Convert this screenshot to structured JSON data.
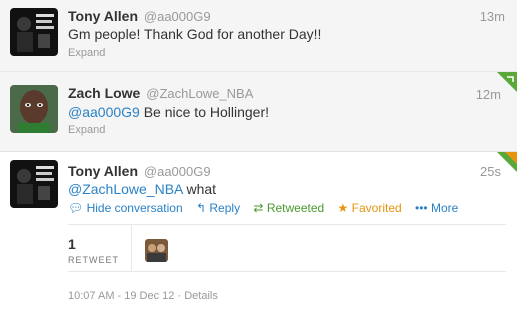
{
  "tweets": [
    {
      "name": "Tony Allen",
      "handle": "@aa000G9",
      "time": "13m",
      "text": "Gm people! Thank God for another Day!!",
      "expand_label": "Expand"
    },
    {
      "name": "Zach Lowe",
      "handle": "@ZachLowe_NBA",
      "time": "12m",
      "mention": "@aa000G9",
      "text": " Be nice to Hollinger!",
      "expand_label": "Expand"
    },
    {
      "name": "Tony Allen",
      "handle": "@aa000G9",
      "time": "25s",
      "mention": "@ZachLowe_NBA",
      "text": " what",
      "actions": {
        "hide": "Hide conversation",
        "reply": "Reply",
        "retweeted": "Retweeted",
        "favorited": "Favorited",
        "more": "More"
      },
      "stats": {
        "retweet_count": "1",
        "retweet_label": "RETWEET"
      },
      "timestamp": "10:07 AM - 19 Dec 12",
      "details_label": "Details"
    }
  ],
  "colors": {
    "link": "#2a82c7",
    "retweet_green": "#4a9a2d",
    "favorite_orange": "#e8940f"
  }
}
